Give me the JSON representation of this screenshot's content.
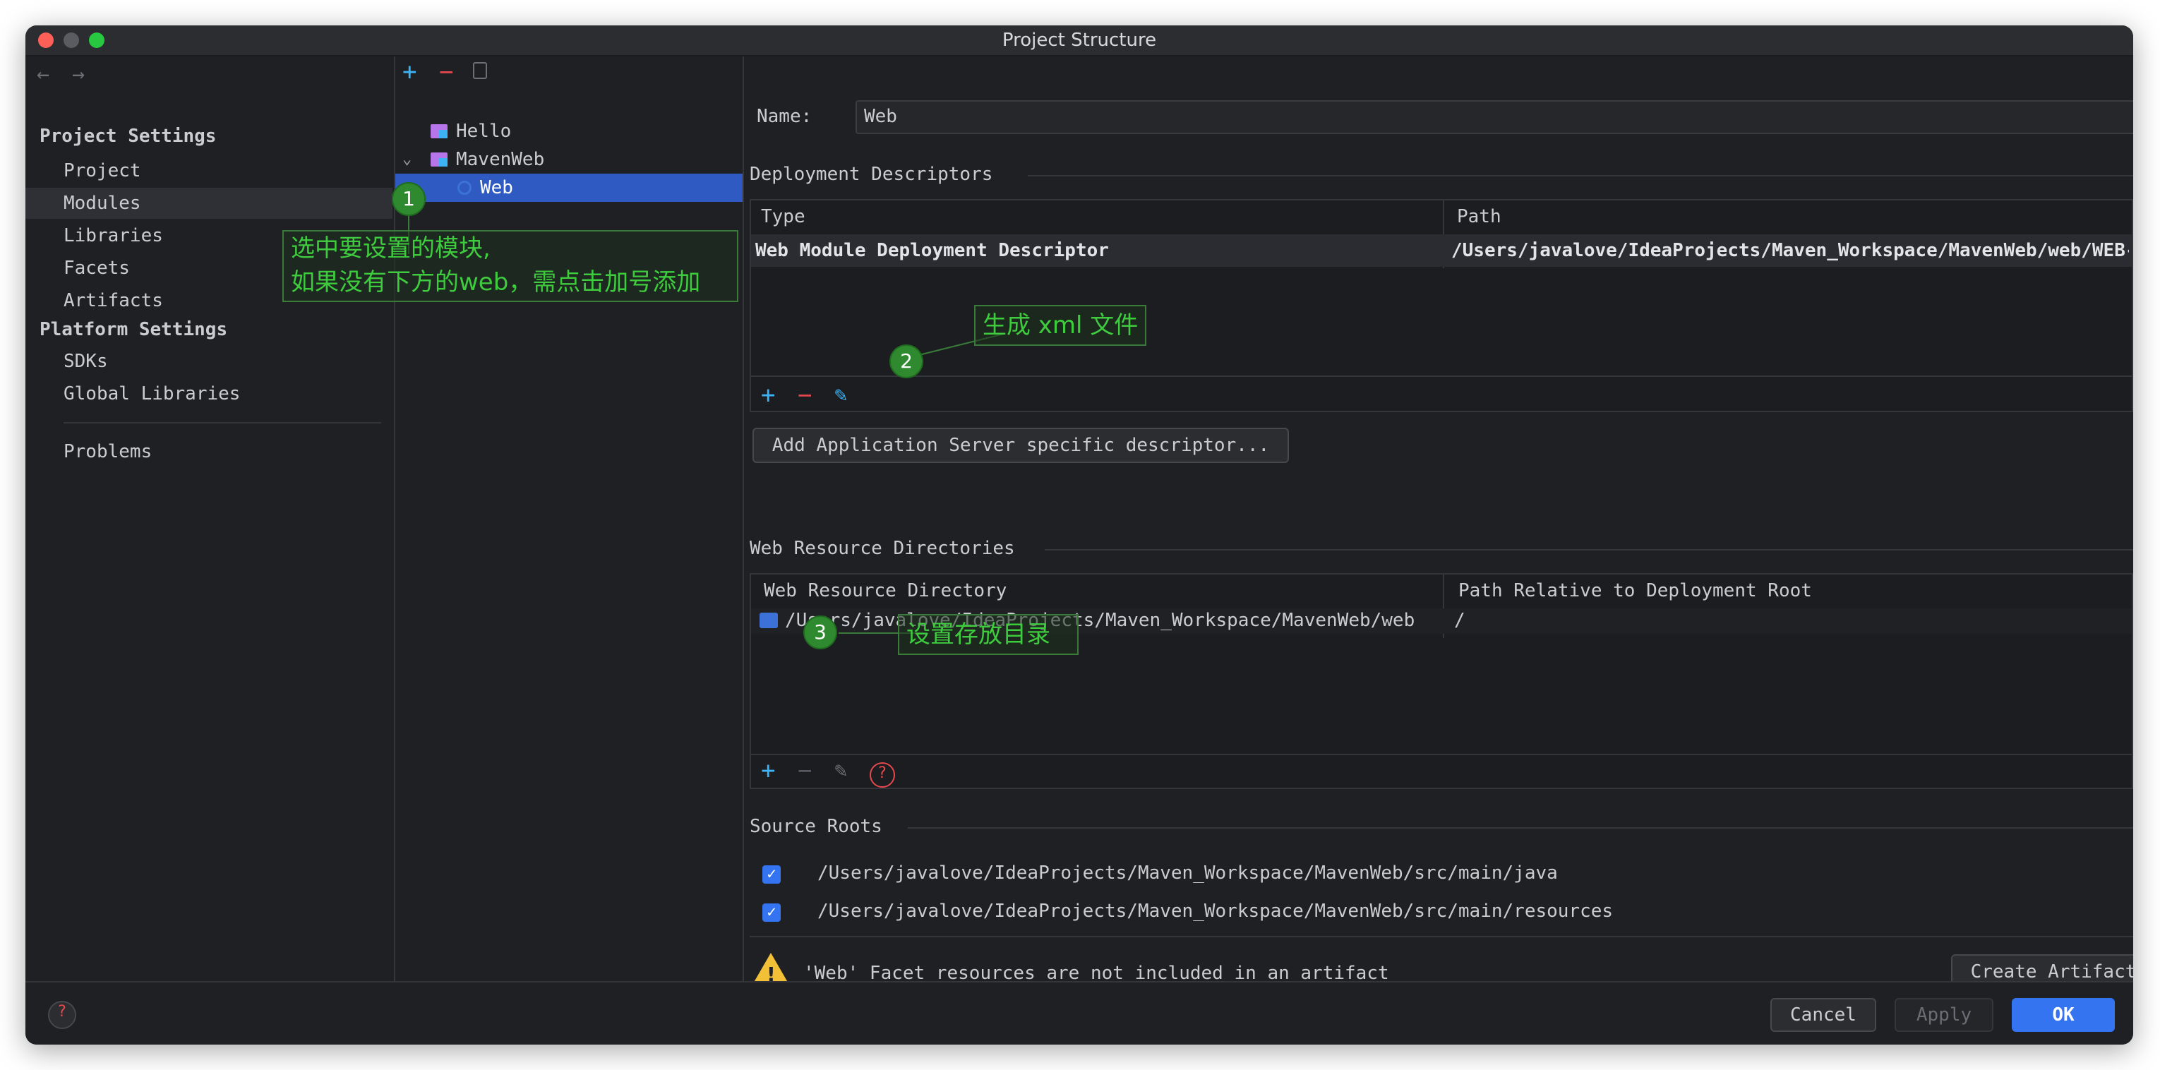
{
  "window": {
    "title": "Project Structure"
  },
  "left": {
    "project_settings_header": "Project Settings",
    "project_items": [
      "Project",
      "Modules",
      "Libraries",
      "Facets",
      "Artifacts"
    ],
    "platform_settings_header": "Platform Settings",
    "platform_items": [
      "SDKs",
      "Global Libraries"
    ],
    "problems": "Problems",
    "selected": "Modules"
  },
  "tree": {
    "items": [
      {
        "label": "Hello",
        "icon": "module-folder-icon"
      },
      {
        "label": "MavenWeb",
        "icon": "module-folder-icon",
        "expanded": true
      },
      {
        "label": "Web",
        "icon": "web-facet-icon",
        "selected": true
      }
    ]
  },
  "details": {
    "name_label": "Name:",
    "name_value": "Web",
    "deployment": {
      "title": "Deployment Descriptors",
      "columns": [
        "Type",
        "Path"
      ],
      "rows": [
        {
          "type": "Web Module Deployment Descriptor",
          "path": "/Users/javalove/IdeaProjects/Maven_Workspace/MavenWeb/web/WEB-"
        }
      ],
      "add_server_button": "Add Application Server specific descriptor..."
    },
    "resources": {
      "title": "Web Resource Directories",
      "columns": [
        "Web Resource Directory",
        "Path Relative to Deployment Root"
      ],
      "rows": [
        {
          "directory": "/Users/javalove/IdeaProjects/Maven_Workspace/MavenWeb/web",
          "relative": "/"
        }
      ]
    },
    "source_roots": {
      "title": "Source Roots",
      "items": [
        {
          "path": "/Users/javalove/IdeaProjects/Maven_Workspace/MavenWeb/src/main/java",
          "checked": true
        },
        {
          "path": "/Users/javalove/IdeaProjects/Maven_Workspace/MavenWeb/src/main/resources",
          "checked": true
        }
      ]
    },
    "warning": "'Web' Facet resources are not included in an artifact",
    "create_artifact_button": "Create Artifact"
  },
  "buttons": {
    "cancel": "Cancel",
    "apply": "Apply",
    "ok": "OK"
  },
  "annotations": {
    "badge1": "1",
    "callout1_line1": "选中要设置的模块,",
    "callout1_line2": "如果没有下方的web，需点击加号添加",
    "badge2": "2",
    "callout2": "生成 xml 文件",
    "badge3": "3",
    "callout3": "设置存放目录"
  },
  "colors": {
    "accent": "#3574f0",
    "selection": "#2e5ac2",
    "annotation_green": "#3ecc3e",
    "remove_red": "#e5484d",
    "add_blue": "#3db2f5",
    "warning_yellow": "#f2c037"
  }
}
